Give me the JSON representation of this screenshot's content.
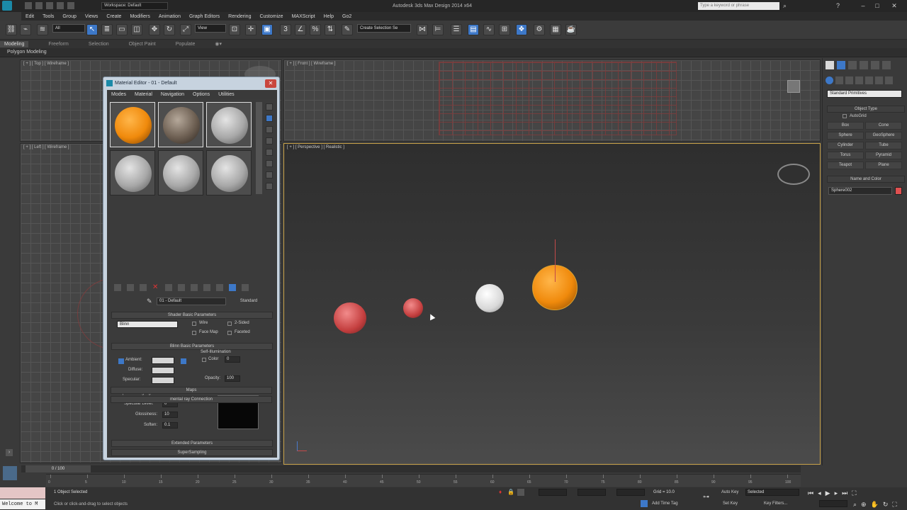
{
  "titlebar": {
    "workspace": "Workspace: Default",
    "window_title": "Autodesk 3ds Max Design 2014 x64",
    "search_placeholder": "Type a keyword or phrase"
  },
  "menu": [
    "Edit",
    "Tools",
    "Group",
    "Views",
    "Create",
    "Modifiers",
    "Animation",
    "Graph Editors",
    "Rendering",
    "Customize",
    "MAXScript",
    "Help",
    "Go2"
  ],
  "toolbar": {
    "filter": "All",
    "view": "View",
    "selection_set": "Create Selection Se"
  },
  "ribbon": {
    "tabs": [
      "Modeling",
      "Freeform",
      "Selection",
      "Object Paint",
      "Populate"
    ],
    "sub": "Polygon Modeling"
  },
  "viewports": {
    "top": "[ + ] [ Top ] [ Wireframe ]",
    "front": "[ + ] [ Front ] [ Wireframe ]",
    "left": "[ + ] [ Left ] [ Wireframe ]",
    "perspective": "[ + ] [ Perspective ] [ Realistic ]"
  },
  "material_editor": {
    "title": "Material Editor - 01 - Default",
    "menu": [
      "Modes",
      "Material",
      "Navigation",
      "Options",
      "Utilities"
    ],
    "material_name": "01 - Default",
    "material_type": "Standard",
    "shader_header": "Shader Basic Parameters",
    "shader": "Blinn",
    "wire": "Wire",
    "two_sided": "2-Sided",
    "face_map": "Face Map",
    "faceted": "Faceted",
    "blinn_header": "Blinn Basic Parameters",
    "self_illum": "Self-Illumination",
    "ambient": "Ambient:",
    "diffuse": "Diffuse:",
    "specular": "Specular:",
    "color": "Color",
    "color_value": "0",
    "opacity": "Opacity:",
    "opacity_value": "100",
    "highlights_header": "Specular Highlights",
    "spec_level": "Specular Level:",
    "spec_level_value": "0",
    "glossiness": "Glossiness:",
    "glossiness_value": "10",
    "soften": "Soften:",
    "soften_value": "0.1",
    "rollouts": [
      "Extended Parameters",
      "SuperSampling",
      "Maps",
      "mental ray Connection"
    ]
  },
  "command_panel": {
    "dropdown": "Standard Primitives",
    "object_type": "Object Type",
    "autogrid": "AutoGrid",
    "buttons": [
      "Box",
      "Cone",
      "Sphere",
      "GeoSphere",
      "Cylinder",
      "Tube",
      "Torus",
      "Pyramid",
      "Teapot",
      "Plane"
    ],
    "name_color": "Name and Color",
    "object_name": "Sphere002",
    "name_color_hex": "#e05050"
  },
  "timeline": {
    "frame": "0 / 100",
    "ticks": [
      0,
      5,
      10,
      15,
      20,
      25,
      30,
      35,
      40,
      45,
      50,
      55,
      60,
      65,
      70,
      75,
      80,
      85,
      90,
      95,
      100
    ]
  },
  "status": {
    "selected": "1 Object Selected",
    "prompt": "Click or click-and-drag to select objects",
    "welcome": "Welcome to M",
    "grid": "Grid = 10.0",
    "auto_key": "Auto Key",
    "set_key": "Set Key",
    "selected_dropdown": "Selected",
    "key_filters": "Key Filters...",
    "add_time_tag": "Add Time Tag"
  }
}
